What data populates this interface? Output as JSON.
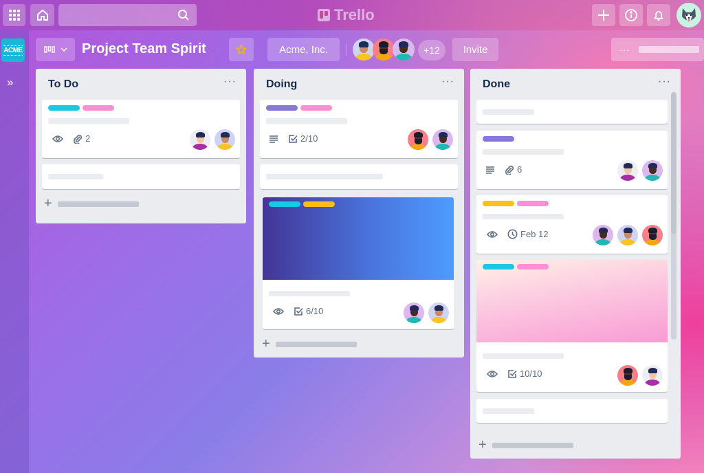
{
  "app": {
    "name": "Trello"
  },
  "topbar": {
    "apps_icon": "grid-icon",
    "home_icon": "home-icon",
    "search_placeholder": "",
    "search_icon": "search-icon",
    "create_icon": "plus-icon",
    "info_icon": "info-icon",
    "notifications_icon": "bell-icon",
    "user_avatar": "husky-avatar"
  },
  "sidebar": {
    "workspace_badge": "ACME",
    "expand_icon": "double-chevron-right-icon"
  },
  "board": {
    "title": "Project Team Spirit",
    "view_switcher_icon": "board-view-icon",
    "starred": true,
    "workspace": "Acme, Inc.",
    "member_overflow": "+12",
    "invite_label": "Invite",
    "menu_label": "···"
  },
  "colors": {
    "cyan": "#1ac7e4",
    "pink": "#ff8ed4",
    "purple": "#8777d9",
    "yellow": "#ffbe1a",
    "star": "#f5b900"
  },
  "lists": [
    {
      "title": "To Do",
      "menu": "···",
      "cards": [
        {
          "labels": [
            "cyan",
            "pink"
          ],
          "badges": [
            {
              "icon": "eye-icon"
            },
            {
              "icon": "paperclip-icon",
              "text": "2"
            }
          ],
          "members": [
            "woman-purple",
            "man-yellow"
          ]
        },
        {
          "labels": [],
          "badges": [],
          "members": []
        }
      ]
    },
    {
      "title": "Doing",
      "menu": "···",
      "cards": [
        {
          "labels": [
            "purple",
            "pink"
          ],
          "badges": [
            {
              "icon": "description-icon"
            },
            {
              "icon": "checklist-icon",
              "text": "2/10"
            }
          ],
          "members": [
            "bearded-man",
            "woman-teal"
          ]
        },
        {
          "labels": [],
          "badges": [],
          "members": []
        },
        {
          "cover": "blue-gradient",
          "labels": [
            "cyan",
            "yellow"
          ],
          "badges": [
            {
              "icon": "eye-icon"
            },
            {
              "icon": "checklist-icon",
              "text": "6/10"
            }
          ],
          "members": [
            "woman-teal",
            "man-yellow"
          ]
        }
      ]
    },
    {
      "title": "Done",
      "menu": "···",
      "cards": [
        {
          "labels": [],
          "badges": [],
          "members": []
        },
        {
          "labels": [
            "purple"
          ],
          "badges": [
            {
              "icon": "description-icon"
            },
            {
              "icon": "paperclip-icon",
              "text": "6"
            }
          ],
          "members": [
            "woman-purple",
            "woman-teal"
          ]
        },
        {
          "labels": [
            "yellow",
            "pink"
          ],
          "badges": [
            {
              "icon": "eye-icon"
            },
            {
              "icon": "clock-icon",
              "text": "Feb 12"
            }
          ],
          "members": [
            "woman-teal",
            "man-yellow",
            "bearded-man"
          ]
        },
        {
          "cover": "pink-gradient",
          "labels": [
            "cyan",
            "pink"
          ],
          "badges": [
            {
              "icon": "eye-icon"
            },
            {
              "icon": "checklist-icon",
              "text": "10/10"
            }
          ],
          "members": [
            "bearded-man",
            "woman-purple"
          ]
        },
        {
          "labels": [],
          "badges": [],
          "members": []
        }
      ]
    }
  ]
}
